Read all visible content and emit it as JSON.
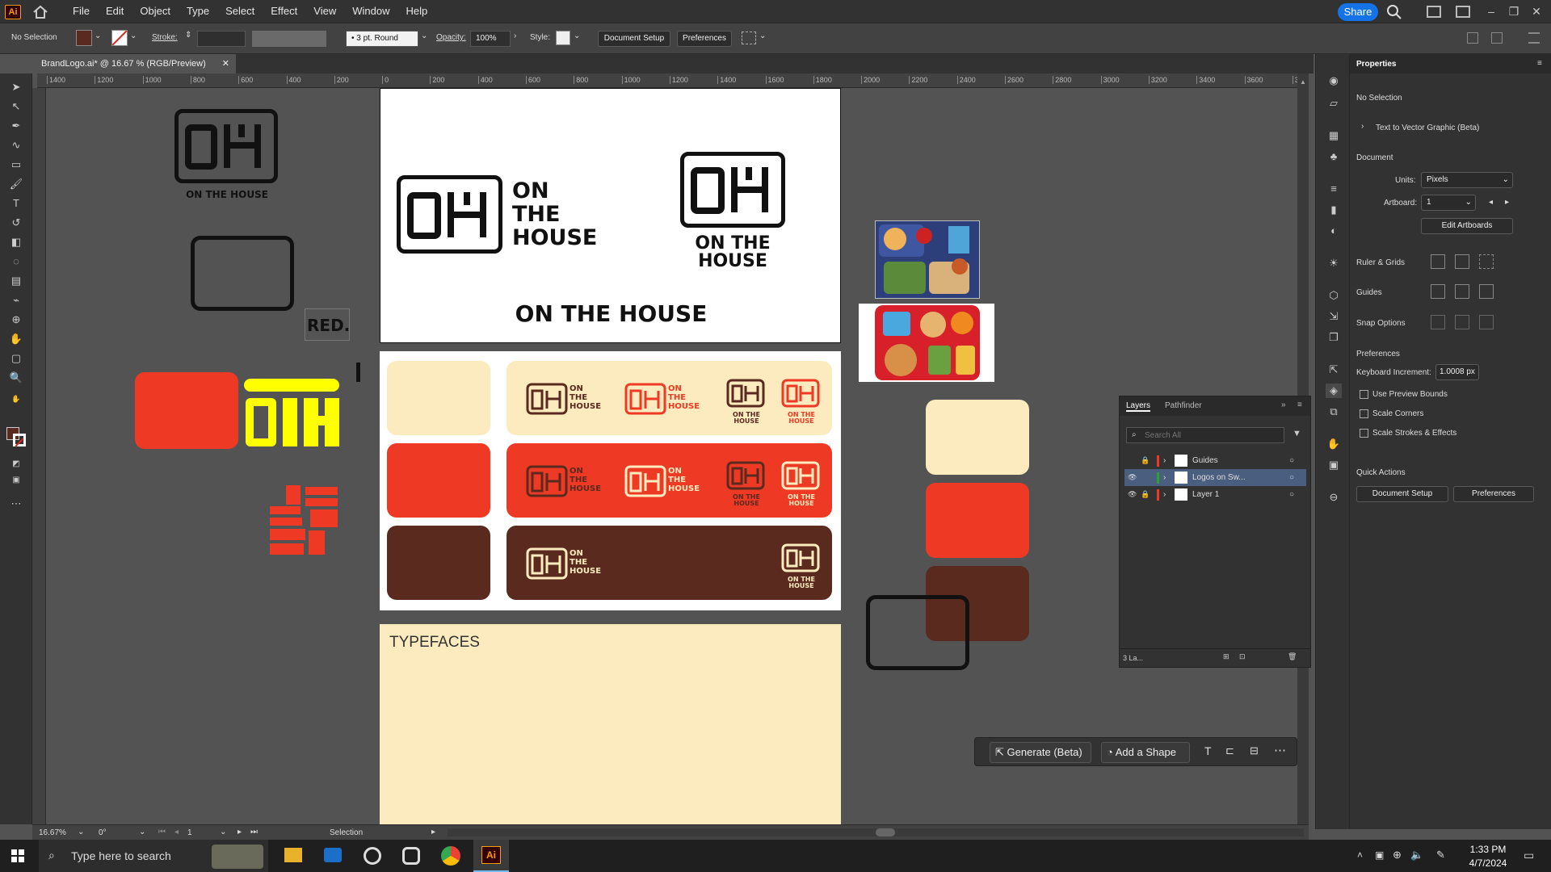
{
  "menubar": {
    "app_icon": "Ai",
    "items": [
      "File",
      "Edit",
      "Object",
      "Type",
      "Select",
      "Effect",
      "View",
      "Window",
      "Help"
    ],
    "share_label": "Share"
  },
  "controlbar": {
    "selection": "No Selection",
    "stroke_label": "Stroke:",
    "brush": "3 pt. Round",
    "opacity_label": "Opacity:",
    "opacity_value": "100%",
    "style_label": "Style:",
    "document_setup": "Document Setup",
    "preferences": "Preferences"
  },
  "document": {
    "tab_title": "BrandLogo.ai* @ 16.67 % (RGB/Preview)"
  },
  "ruler": {
    "ticks": [
      "1400",
      "1200",
      "1000",
      "800",
      "600",
      "400",
      "200",
      "0",
      "200",
      "400",
      "600",
      "800",
      "1000",
      "1200",
      "1400",
      "1600",
      "1800",
      "2000",
      "2200",
      "2400",
      "2600",
      "2800",
      "3000",
      "3200",
      "3400",
      "3600",
      "38"
    ]
  },
  "artboard": {
    "logo_text_line1": "ON",
    "logo_text_line2": "THE",
    "logo_text_line3": "HOUSE",
    "stacked_line1": "ON THE",
    "stacked_line2": "HOUSE",
    "wordmark": "ON THE HOUSE",
    "red_label": "RED.",
    "typefaces": "TYPEFACES"
  },
  "colors": {
    "cream": "#fdebc0",
    "red": "#ee3a24",
    "brown": "#5a2a1f",
    "yellow": "#ffff00",
    "accent": "#1473e6"
  },
  "floating_bar": {
    "generate": "Generate (Beta)",
    "add_shape": "Add a Shape"
  },
  "layers_panel": {
    "tab_layers": "Layers",
    "tab_pathfinder": "Pathfinder",
    "search_placeholder": "Search All",
    "rows": [
      {
        "name": "Guides",
        "color": "#ee3a24"
      },
      {
        "name": "Logos on Sw...",
        "color": "#2ca02c"
      },
      {
        "name": "Layer 1",
        "color": "#ee3a24"
      }
    ],
    "count": "3 La..."
  },
  "properties": {
    "title": "Properties",
    "no_selection": "No Selection",
    "text_to_vector": "Text to Vector Graphic (Beta)",
    "document_heading": "Document",
    "units_label": "Units:",
    "units_value": "Pixels",
    "artboard_label": "Artboard:",
    "artboard_value": "1",
    "edit_artboards": "Edit Artboards",
    "ruler_grids": "Ruler & Grids",
    "guides": "Guides",
    "snap_options": "Snap Options",
    "preferences_heading": "Preferences",
    "keyboard_increment_label": "Keyboard Increment:",
    "keyboard_increment_value": "1.0008 px",
    "use_preview_bounds": "Use Preview Bounds",
    "scale_corners": "Scale Corners",
    "scale_strokes": "Scale Strokes & Effects",
    "quick_actions": "Quick Actions",
    "qa_document_setup": "Document Setup",
    "qa_preferences": "Preferences"
  },
  "statusbar": {
    "zoom": "16.67%",
    "rotate": "0°",
    "artboard_num": "1",
    "tool": "Selection"
  },
  "taskbar": {
    "search_placeholder": "Type here to search",
    "time": "1:33 PM",
    "date": "4/7/2024"
  }
}
